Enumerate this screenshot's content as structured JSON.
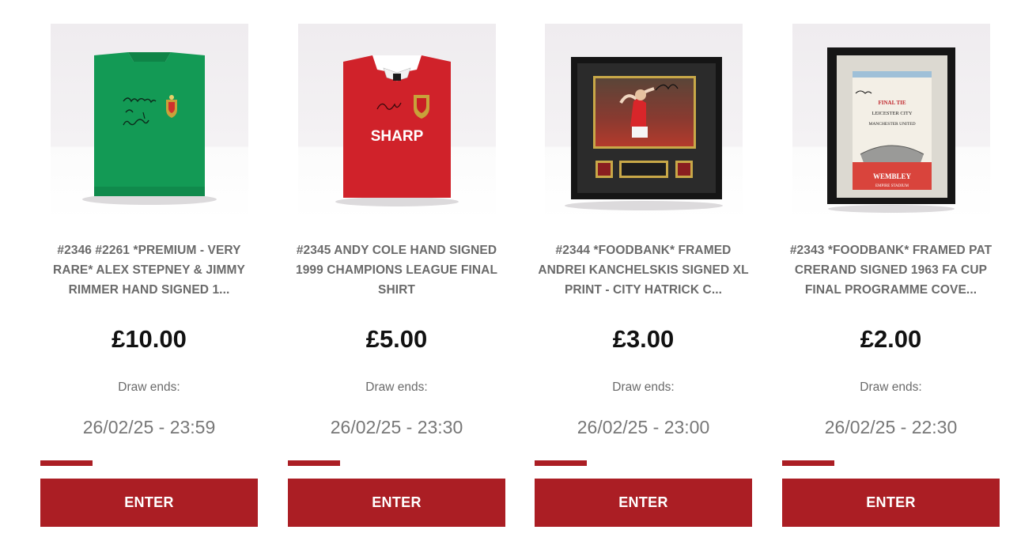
{
  "products": [
    {
      "title": "#2346 #2261 *PREMIUM - VERY RARE* ALEX STEPNEY & JIMMY RIMMER HAND SIGNED 1...",
      "image": "green-signed-goalkeeper-shirt",
      "price": "£10.00",
      "draw_label": "Draw ends:",
      "draw_date": "26/02/25 - 23:59",
      "progress_fraction": 0.24,
      "button_label": "ENTER"
    },
    {
      "title": "#2345 ANDY COLE HAND SIGNED 1999 CHAMPIONS LEAGUE FINAL SHIRT",
      "image": "red-signed-sharp-shirt",
      "shirt_sponsor": "SHARP",
      "price": "£5.00",
      "draw_label": "Draw ends:",
      "draw_date": "26/02/25 - 23:30",
      "progress_fraction": 0.24,
      "button_label": "ENTER"
    },
    {
      "title": "#2344 *FOODBANK* FRAMED ANDREI KANCHELSKIS SIGNED XL PRINT - CITY HATRICK C...",
      "image": "framed-signed-photo",
      "price": "£3.00",
      "draw_label": "Draw ends:",
      "draw_date": "26/02/25 - 23:00",
      "progress_fraction": 0.24,
      "button_label": "ENTER"
    },
    {
      "title": "#2343 *FOODBANK* FRAMED PAT CRERAND SIGNED 1963 FA CUP FINAL PROGRAMME COVE...",
      "image": "framed-signed-programme",
      "programme": {
        "heading": "FINAL TIE",
        "team_one": "LEICESTER CITY",
        "team_two": "MANCHESTER UNITED",
        "venue": "WEMBLEY",
        "stadium": "EMPIRE STADIUM"
      },
      "price": "£2.00",
      "draw_label": "Draw ends:",
      "draw_date": "26/02/25 - 22:30",
      "progress_fraction": 0.24,
      "button_label": "ENTER"
    }
  ],
  "colors": {
    "accent": "#ab1e24",
    "title_text": "#6a6a6a",
    "price_text": "#111111"
  }
}
